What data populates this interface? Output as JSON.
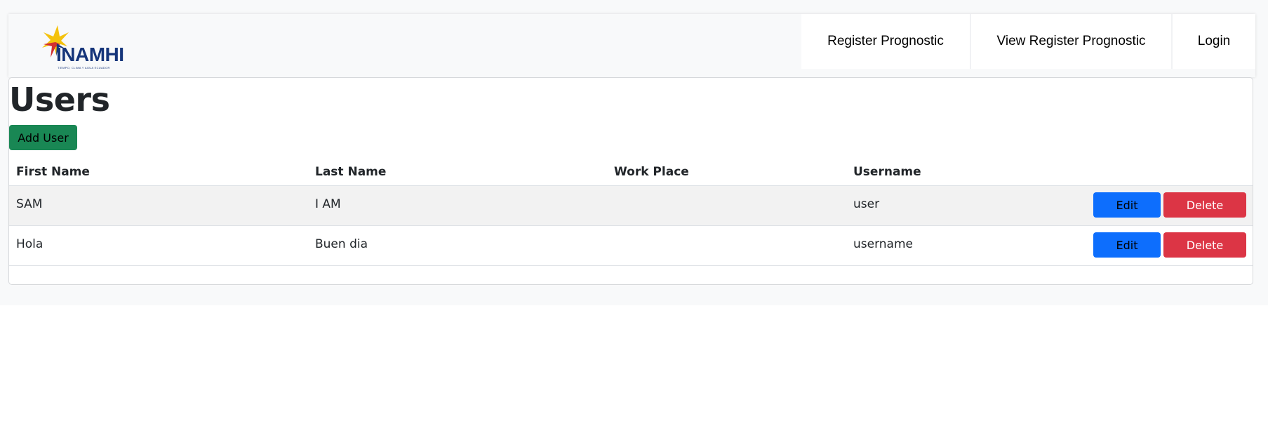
{
  "logo": {
    "text": "INAMHI",
    "subtitle": "TIEMPO, CLIMA Y AGUA ECUADOR"
  },
  "nav": {
    "items": [
      {
        "label": "Register Prognostic"
      },
      {
        "label": "View Register Prognostic"
      },
      {
        "label": "Login"
      }
    ]
  },
  "main": {
    "title": "Users",
    "add_label": "Add User",
    "columns": [
      "First Name",
      "Last Name",
      "Work Place",
      "Username"
    ],
    "rows": [
      {
        "first_name": "SAM",
        "last_name": "I AM",
        "work_place": "",
        "username": "user"
      },
      {
        "first_name": "Hola",
        "last_name": "Buen dia",
        "work_place": "",
        "username": "username"
      }
    ],
    "edit_label": "Edit",
    "delete_label": "Delete"
  },
  "colors": {
    "success": "#198754",
    "primary": "#0d6efd",
    "danger": "#dc3545",
    "logo_blue": "#16357a",
    "logo_yellow": "#f4c20d",
    "logo_red": "#d32f2f"
  }
}
